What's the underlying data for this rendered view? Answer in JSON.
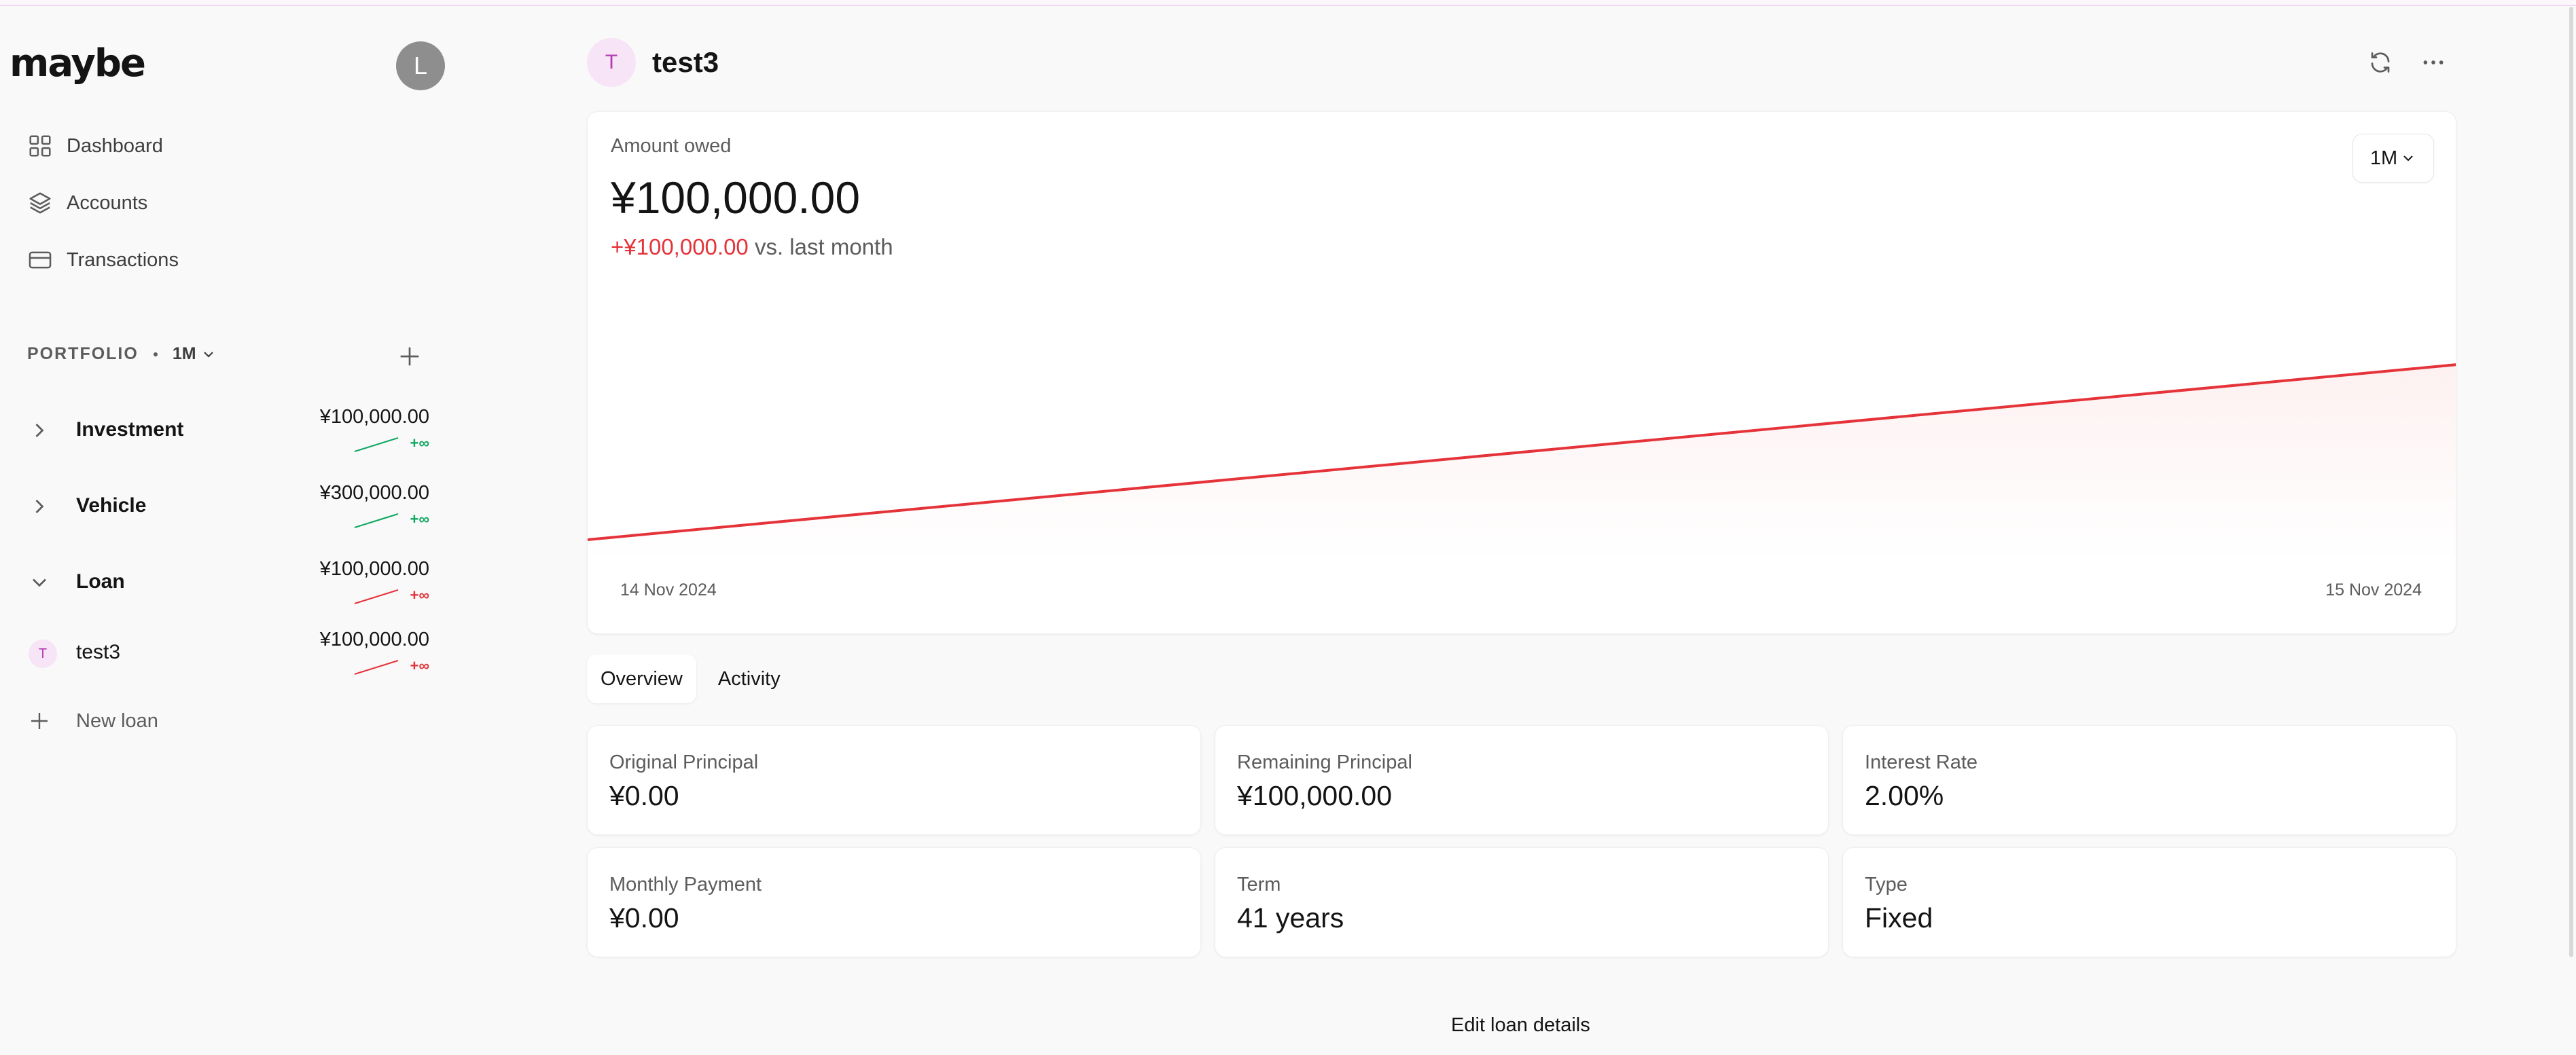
{
  "app": {
    "logo": "maybe",
    "user_initial": "L"
  },
  "nav": [
    {
      "label": "Dashboard",
      "icon": "dashboard-grid-icon"
    },
    {
      "label": "Accounts",
      "icon": "layers-icon"
    },
    {
      "label": "Transactions",
      "icon": "credit-card-icon"
    }
  ],
  "portfolio": {
    "title": "PORTFOLIO",
    "period": "1M",
    "groups": [
      {
        "name": "Investment",
        "value": "¥100,000.00",
        "trend": "+∞",
        "trend_color": "#10a861",
        "expanded": false
      },
      {
        "name": "Vehicle",
        "value": "¥300,000.00",
        "trend": "+∞",
        "trend_color": "#10a861",
        "expanded": false
      },
      {
        "name": "Loan",
        "value": "¥100,000.00",
        "trend": "+∞",
        "trend_color": "#e5333a",
        "expanded": true
      }
    ],
    "accounts": [
      {
        "initial": "T",
        "name": "test3",
        "value": "¥100,000.00",
        "trend": "+∞",
        "trend_color": "#e5333a"
      }
    ],
    "new_loan_label": "New loan"
  },
  "account": {
    "initial": "T",
    "name": "test3"
  },
  "summary": {
    "label": "Amount owed",
    "value": "¥100,000.00",
    "change": "+¥100,000.00",
    "change_suffix": "vs. last month",
    "range": "1M"
  },
  "chart_data": {
    "type": "line",
    "x": [
      "14 Nov 2024",
      "15 Nov 2024"
    ],
    "series": [
      {
        "values": [
          0,
          100000
        ]
      }
    ],
    "color": "#e5333a",
    "grid": false
  },
  "tabs": [
    {
      "label": "Overview",
      "active": true
    },
    {
      "label": "Activity",
      "active": false
    }
  ],
  "details": [
    {
      "label": "Original Principal",
      "value": "¥0.00"
    },
    {
      "label": "Remaining Principal",
      "value": "¥100,000.00"
    },
    {
      "label": "Interest Rate",
      "value": "2.00%"
    },
    {
      "label": "Monthly Payment",
      "value": "¥0.00"
    },
    {
      "label": "Term",
      "value": "41 years"
    },
    {
      "label": "Type",
      "value": "Fixed"
    }
  ],
  "edit_label": "Edit loan details"
}
